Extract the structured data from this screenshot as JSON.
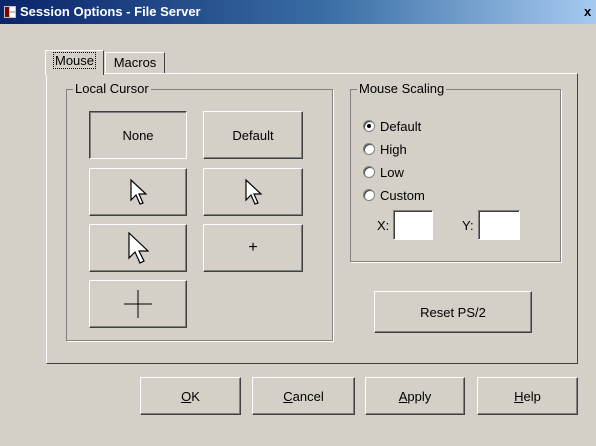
{
  "window": {
    "title": "Session Options - File Server",
    "close_glyph": "x"
  },
  "tabs": [
    {
      "label": "Mouse",
      "active": true
    },
    {
      "label": "Macros",
      "active": false
    }
  ],
  "local_cursor": {
    "legend": "Local Cursor",
    "none_label": "None",
    "default_label": "Default",
    "options": [
      "arrow-outline-small-icon",
      "arrow-outline-icon",
      "arrow-outline-large-icon",
      "small-crosshair-icon",
      "large-crosshair-icon"
    ],
    "small_crosshair_glyph": "+",
    "selected": "None"
  },
  "mouse_scaling": {
    "legend": "Mouse Scaling",
    "options": [
      {
        "label": "Default",
        "checked": true
      },
      {
        "label": "High",
        "checked": false
      },
      {
        "label": "Low",
        "checked": false
      },
      {
        "label": "Custom",
        "checked": false
      }
    ],
    "x_label": "X:",
    "y_label": "Y:",
    "x_value": "",
    "y_value": ""
  },
  "reset_button": "Reset PS/2",
  "footer": {
    "ok": {
      "accel": "O",
      "rest": "K"
    },
    "cancel": {
      "accel": "C",
      "rest": "ancel"
    },
    "apply": {
      "accel": "A",
      "rest": "pply"
    },
    "help": {
      "accel": "H",
      "rest": "elp"
    }
  },
  "colors": {
    "face": "#d4d0c8",
    "titlebar_start": "#0a246a",
    "titlebar_end": "#a6caf0"
  }
}
